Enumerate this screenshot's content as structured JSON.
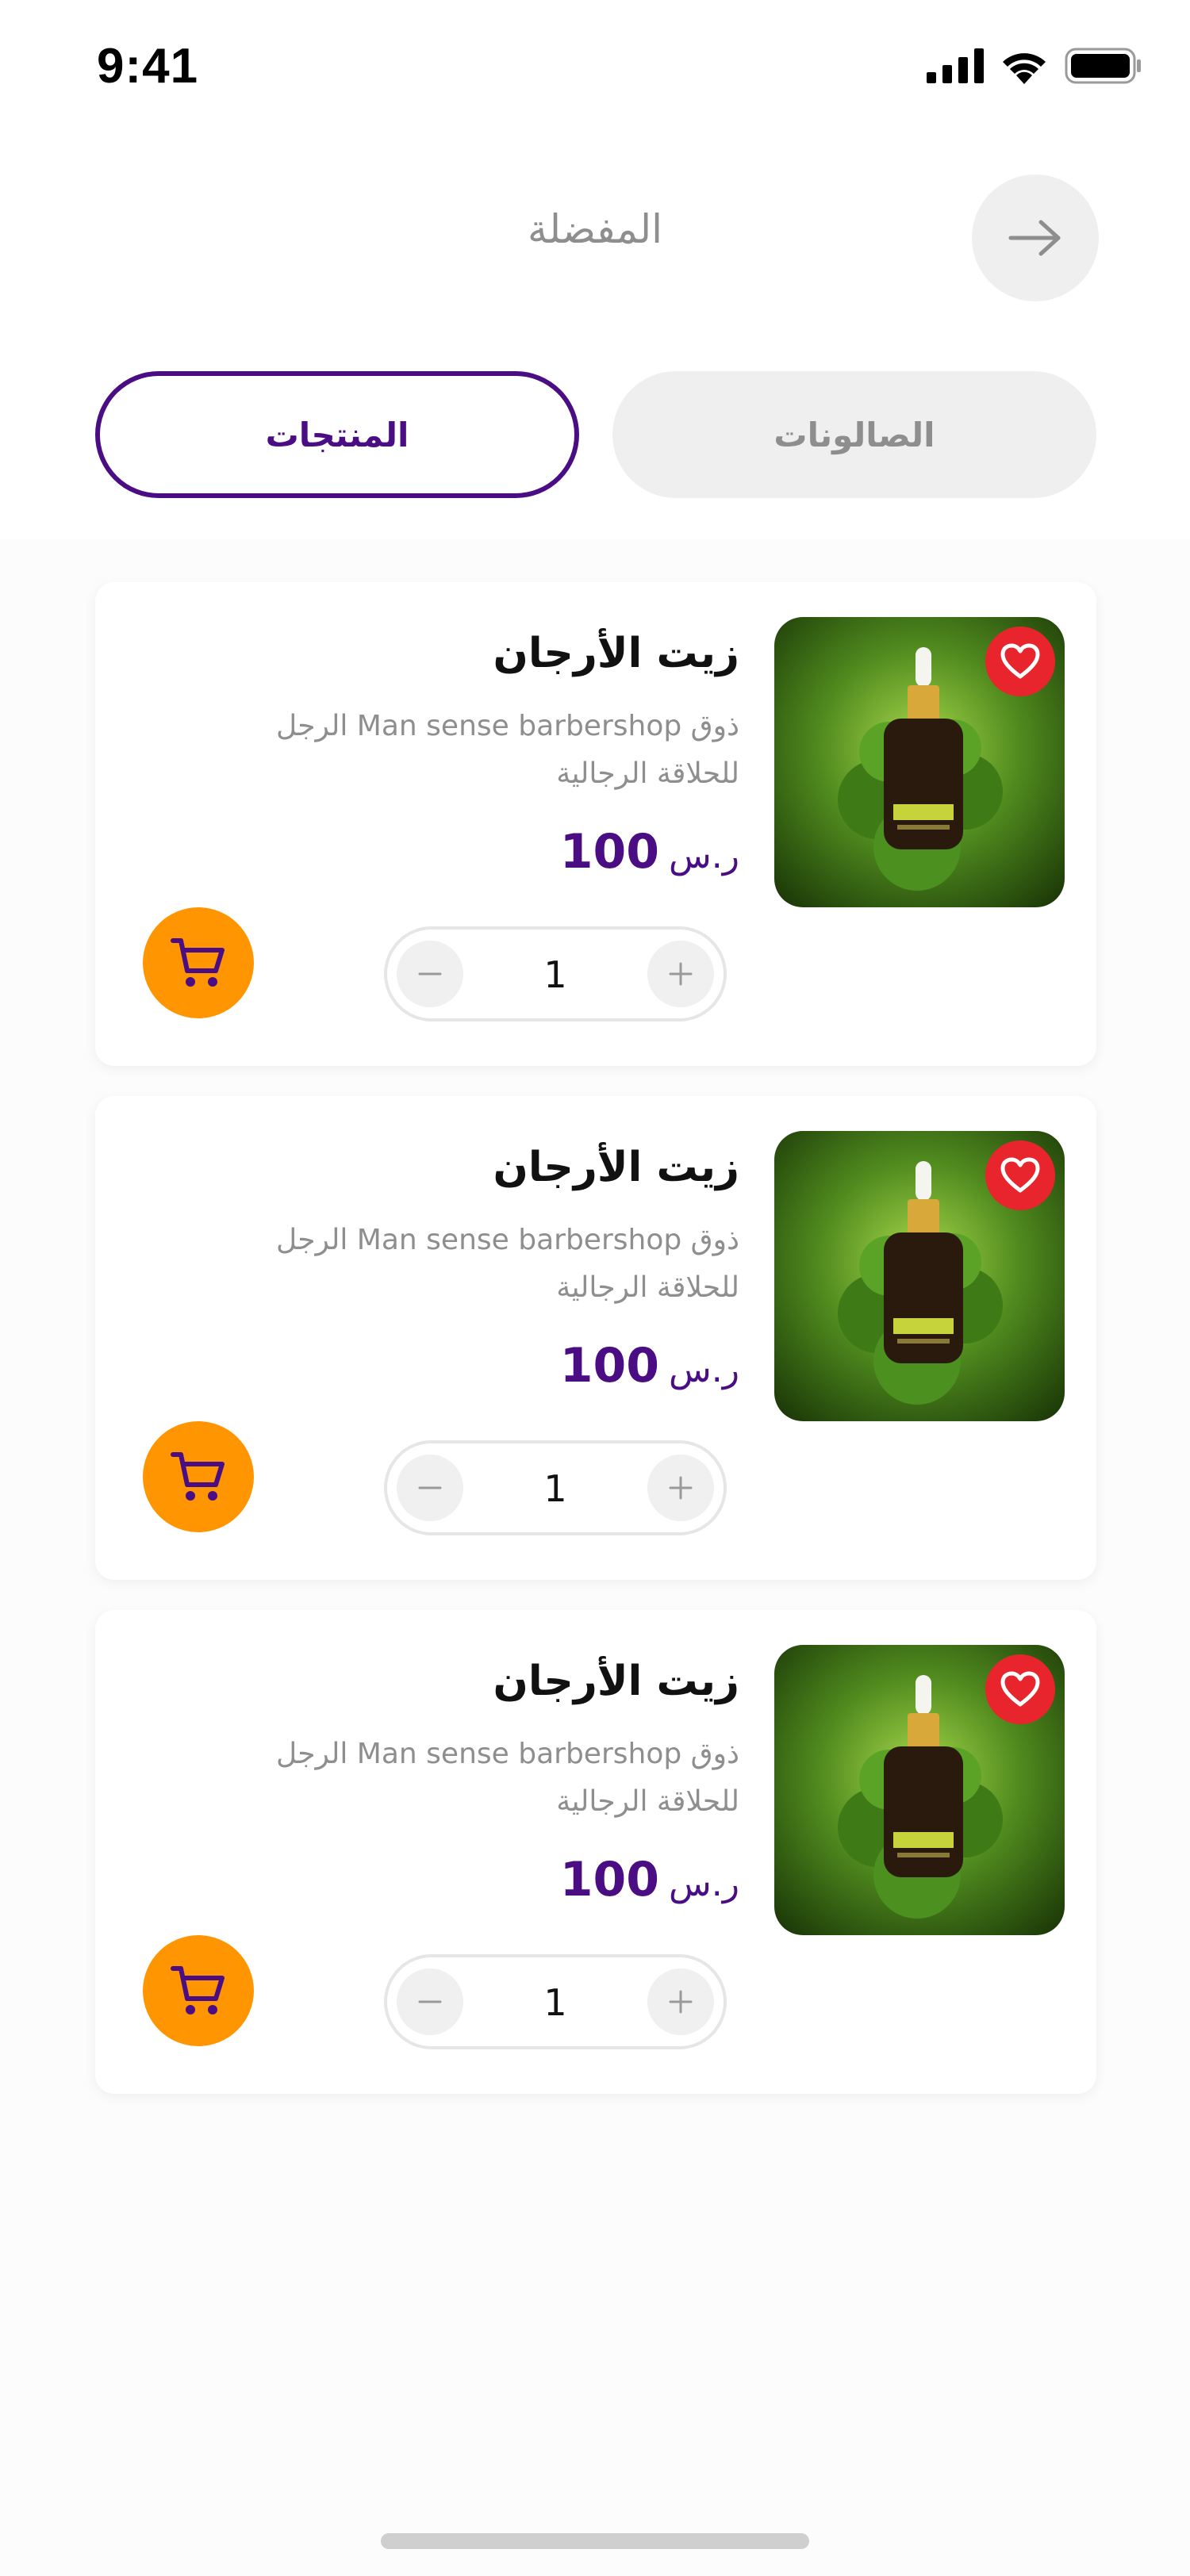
{
  "status_bar": {
    "time": "9:41"
  },
  "header": {
    "title": "المفضلة"
  },
  "tabs": {
    "products": "المنتجات",
    "salons": "الصالونات"
  },
  "products": [
    {
      "title": "زيت الأرجان",
      "description": "ذوق Man sense barbershop الرجل للحلاقة الرجالية",
      "price": "100",
      "currency": "ر.س",
      "quantity": "1"
    },
    {
      "title": "زيت الأرجان",
      "description": "ذوق Man sense barbershop الرجل للحلاقة الرجالية",
      "price": "100",
      "currency": "ر.س",
      "quantity": "1"
    },
    {
      "title": "زيت الأرجان",
      "description": "ذوق Man sense barbershop الرجل للحلاقة الرجالية",
      "price": "100",
      "currency": "ر.س",
      "quantity": "1"
    }
  ],
  "icons": {
    "back": "arrow-right-icon",
    "favorite": "heart-icon",
    "cart": "shopping-cart-icon",
    "minus": "minus-icon",
    "plus": "plus-icon"
  },
  "colors": {
    "primary": "#4b0d84",
    "favorite": "#e8252c",
    "cart": "#ff9500",
    "muted_text": "#8e8e8e"
  }
}
